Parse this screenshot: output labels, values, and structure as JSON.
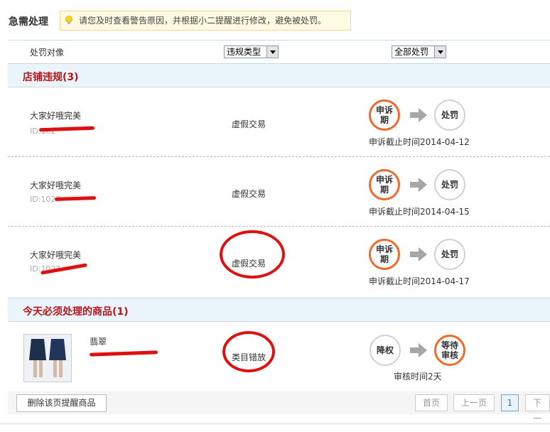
{
  "header": {
    "title": "急需处理",
    "tip": "请您及时查看警告原因，并根据小二提醒进行修改，避免被处罚。"
  },
  "filters": {
    "col_object": "处罚对像",
    "violation_type": "违规类型",
    "all_penalty": "全部处罚"
  },
  "section_store": {
    "title": "店铺违规(3)"
  },
  "store_rows": [
    {
      "name": "大家好哦完美",
      "id": "ID:102",
      "type": "虚假交易",
      "step1": "申诉期",
      "step2": "处罚",
      "deadline": "申诉截止时间2014-04-12"
    },
    {
      "name": "大家好哦完美",
      "id": "ID:1027",
      "type": "虚假交易",
      "step1": "申诉期",
      "step2": "处罚",
      "deadline": "申诉截止时间2014-04-15"
    },
    {
      "name": "大家好哦完美",
      "id": "ID:1027",
      "type": "虚假交易",
      "step1": "申诉期",
      "step2": "处罚",
      "deadline": "申诉截止时间2014-04-17"
    }
  ],
  "section_goods": {
    "title": "今天必须处理的商品(1)"
  },
  "goods_row": {
    "name": "翡翠",
    "type": "类目错放",
    "step1": "降权",
    "step2": "等待审核",
    "note": "审核时间2天"
  },
  "footer": {
    "delete_btn": "删除该页提醒商品",
    "first": "首页",
    "prev": "上一页",
    "page": "1",
    "next": "下一"
  },
  "colors": {
    "accent_orange": "#ee6a28",
    "section_red": "#b3161b",
    "annotation_red": "#e01010"
  }
}
